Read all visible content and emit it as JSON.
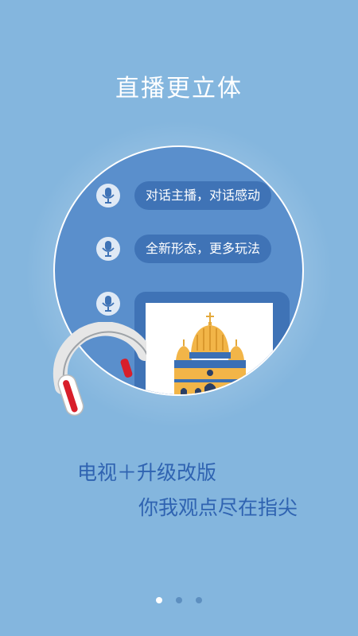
{
  "headline": "直播更立体",
  "bubbles": [
    {
      "text": "对话主播，对话感动"
    },
    {
      "text": "全新形态，更多玩法"
    }
  ],
  "tagline_1": "电视＋升级改版",
  "tagline_2": "你我观点尽在指尖",
  "pagination": {
    "active": 0,
    "count": 3
  },
  "colors": {
    "background": "#84b6de",
    "circle": "#5a8fcc",
    "bubble": "#3f73b6",
    "tagline": "#2f63b1",
    "dot_active": "#ffffff",
    "dot_inactive": "#5d8fc0"
  }
}
